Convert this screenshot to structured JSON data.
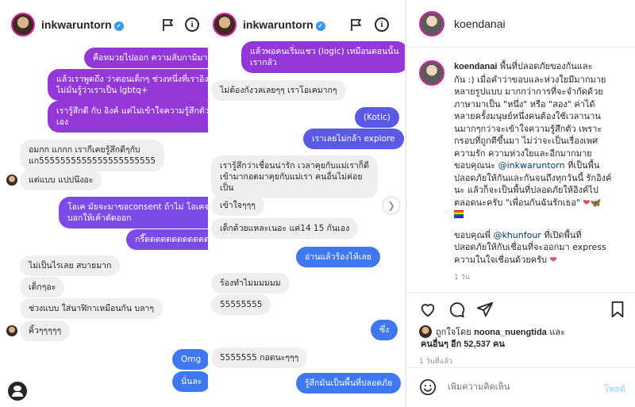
{
  "dm": {
    "username": "inkwaruntorn",
    "left": [
      {
        "text": "คือหมวยไปออก ความลับกามิมา",
        "dir": "out",
        "color": "purple"
      },
      {
        "text": "แล้วเราพูดถึง ว่าตอนเด็กๆ ช่วงหนึ่งที่เราอิง\nไม่มั่นรู้ว่าเราเป็น lgbtq+",
        "dir": "out",
        "color": "purple"
      },
      {
        "text": "เรารู้สึกดี กับ อิงค์ แต่ไม่เข้าใจความรู้สึกตัว\nเอง",
        "dir": "out",
        "color": "purple"
      },
      {
        "text": "อมกก แกกก เรากีเคยรู้สึกดีๆกับ\nแก5555555555555555555555",
        "dir": "in"
      },
      {
        "text": "แต่แบบ แปปนึงอะ",
        "dir": "in"
      },
      {
        "text": "โอเค มัยจะมาขอconsent ถ้าไม่ โอเคจะ\nบอกให้เค้าตัดออก",
        "dir": "out",
        "color": "violet"
      },
      {
        "text": "กรี๊ดดดดดดดดดดดด",
        "dir": "out",
        "color": "violet"
      },
      {
        "text": "ไม่เป็นไรเลย สบายมาก",
        "dir": "in"
      },
      {
        "text": "เด็กๆอะ",
        "dir": "in"
      },
      {
        "text": "ช่วงแบบ ใส่นาฬิกาเหมือนกัน บลาๆ",
        "dir": "in"
      },
      {
        "text": "คิ้วๆๆๆๆๆ",
        "dir": "in"
      },
      {
        "text": "Omg",
        "dir": "out",
        "color": "blue"
      },
      {
        "text": "นั่นละ",
        "dir": "out",
        "color": "blue"
      }
    ],
    "right": [
      {
        "text": "แล้วพอคนเริ่มแชว (logic) เหมือนตอนนั้น\nเรากลัว",
        "dir": "out",
        "color": "purple"
      },
      {
        "text": "ไม่ต้องกังวลเลยๆๆ เราโอเคมากๆ",
        "dir": "in"
      },
      {
        "text": "(Kotic)",
        "dir": "out",
        "color": "indigo"
      },
      {
        "text": "เราเลยไม่กล้า explore",
        "dir": "out",
        "color": "indigo"
      },
      {
        "text": "เรารู้สึกว่าเชื่อนน่ารัก เวลาคุยกับแม่เราก็ดี\nเข้ามากอดมาคุยกับแม่เรา คนอื่นไม่ค่อย\nเป็น",
        "dir": "in"
      },
      {
        "text": "เข้าใจๆๆๆ",
        "dir": "in"
      },
      {
        "text": "เด็กด้วยแหละเนอะ แค่14 15 กันเอง",
        "dir": "in"
      },
      {
        "text": "อ่านแล้วร้องไห้เลย",
        "dir": "out",
        "color": "blue"
      },
      {
        "text": "ร้องทำไมมมมมม",
        "dir": "in"
      },
      {
        "text": "55555555",
        "dir": "in"
      },
      {
        "text": "ซึ่ง",
        "dir": "out",
        "color": "blue"
      },
      {
        "text": "5555555 กอดนะๆๆๆ",
        "dir": "in"
      },
      {
        "text": "รู้สึกมันเป็นพื้นที่ปลอดภัย",
        "dir": "out",
        "color": "blue"
      }
    ]
  },
  "post": {
    "username": "koendanai",
    "caption_lines": [
      "พื้นที่ปลอดภัยของกันและ",
      "กัน :) เมื่อคำว่าขอบและห่วงใยมีมากมาย",
      "หลายรูปแบบ มากกว่าการที่จะจำกัดด้วย",
      "ภาษามาเป็น \"หนึ่ง\" หรือ \"สอง\" ค่าได้",
      "หลายครั้งมนุษย์หนึ่งคนต้องใช้เวลานาน",
      "นมากๆกว่าจะเข้าใจความรู้สึกตัว เพราะ",
      "กรอบที่ถูกตีขึ้นมา ไม่ว่าจะเป็นเรื่องเพศ",
      "ความรัก ความห่วงใยและอีกมากมาย",
      "ขอบคุณนะ",
      "ปลอดภัยให้กันและกันจนถึงทุกวันนี้ รักอิงค์",
      "นะ แล้วก็จะเป็นพื้นที่ปลอดภัยให้อิงค์ไป",
      "ตลอดนะครับ \"เพื่อนกันฉันรักเธอ\""
    ],
    "mention1": "@inkwaruntorn",
    "mention1_after": "ที่เป็นพื้น",
    "thanks_prefix": "ขอบคุณพี่",
    "mention2": "@khunfour",
    "mention2_after": "ที่เปิดพื้นที่",
    "thanks_lines": [
      "ปลอดภัยให้กับเชื่อนที่จะออกมา express",
      "ความในใจเชื่อนด้วยครับ"
    ],
    "caption_time": "1 วัน",
    "liked_by_prefix": "ถูกใจโดย",
    "liked_by_user": "noona_nuengtida",
    "liked_by_and": "และ",
    "others_label": "คนอื่นๆ อีก 52,537 คน",
    "post_time": "1 วันที่แล้ว",
    "comment_placeholder": "เพิ่มความคิดเห็น",
    "post_button": "โพสต์"
  },
  "colors": {
    "purple": "#9338d6",
    "violet": "#7b4be8",
    "blue": "#3f78ee",
    "indigo": "#5a5ae6",
    "heart": "#ed4956",
    "link": "#00376b"
  },
  "icons": [
    "flag-icon",
    "info-icon",
    "heart-icon",
    "comment-icon",
    "share-icon",
    "bookmark-icon",
    "chevron-right-icon",
    "butterfly-emoji",
    "rainbow-flag-emoji"
  ]
}
